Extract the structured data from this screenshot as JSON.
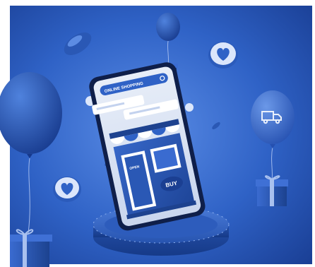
{
  "phone": {
    "search_label": "ONLINE SHOPPING",
    "buy_label": "BUY",
    "door_sign": "OPEN"
  },
  "icons": {
    "search": "search-icon",
    "truck": "delivery-truck-icon",
    "heart": "heart-icon",
    "gift": "gift-box-icon"
  },
  "colors": {
    "background": "#2f5fc0",
    "accent_dark": "#173a8f",
    "accent_light": "#5d8be6",
    "white": "#ffffff"
  }
}
